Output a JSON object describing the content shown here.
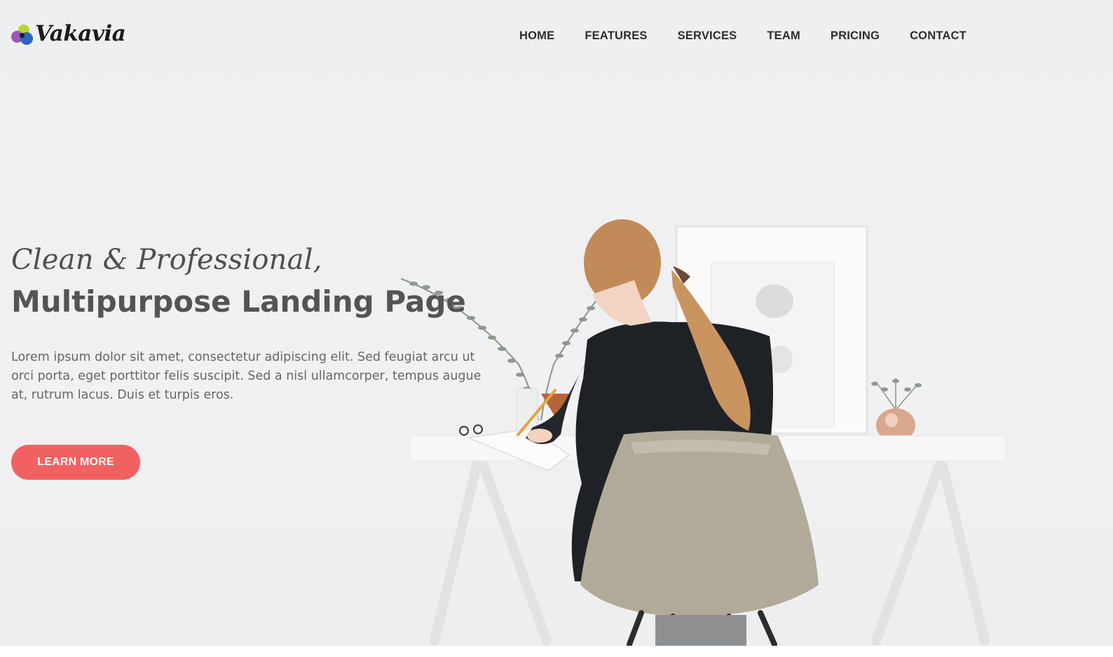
{
  "brand": {
    "name": "Vakavia"
  },
  "nav": {
    "items": [
      "HOME",
      "FEATURES",
      "SERVICES",
      "TEAM",
      "PRICING",
      "CONTACT"
    ]
  },
  "hero": {
    "subtitle": "Clean & Professional,",
    "title": "Multipurpose Landing Page",
    "text": "Lorem ipsum dolor sit amet, consectetur adipiscing elit. Sed feugiat arcu ut orci porta, eget porttitor felis suscipit. Sed a nisl ullamcorper, tempus augue at, rutrum lacus. Duis et turpis eros.",
    "cta_label": "LEARN MORE"
  },
  "colors": {
    "accent": "#f26161",
    "text_dark": "#2d2d2d",
    "text_muted": "#666666"
  }
}
